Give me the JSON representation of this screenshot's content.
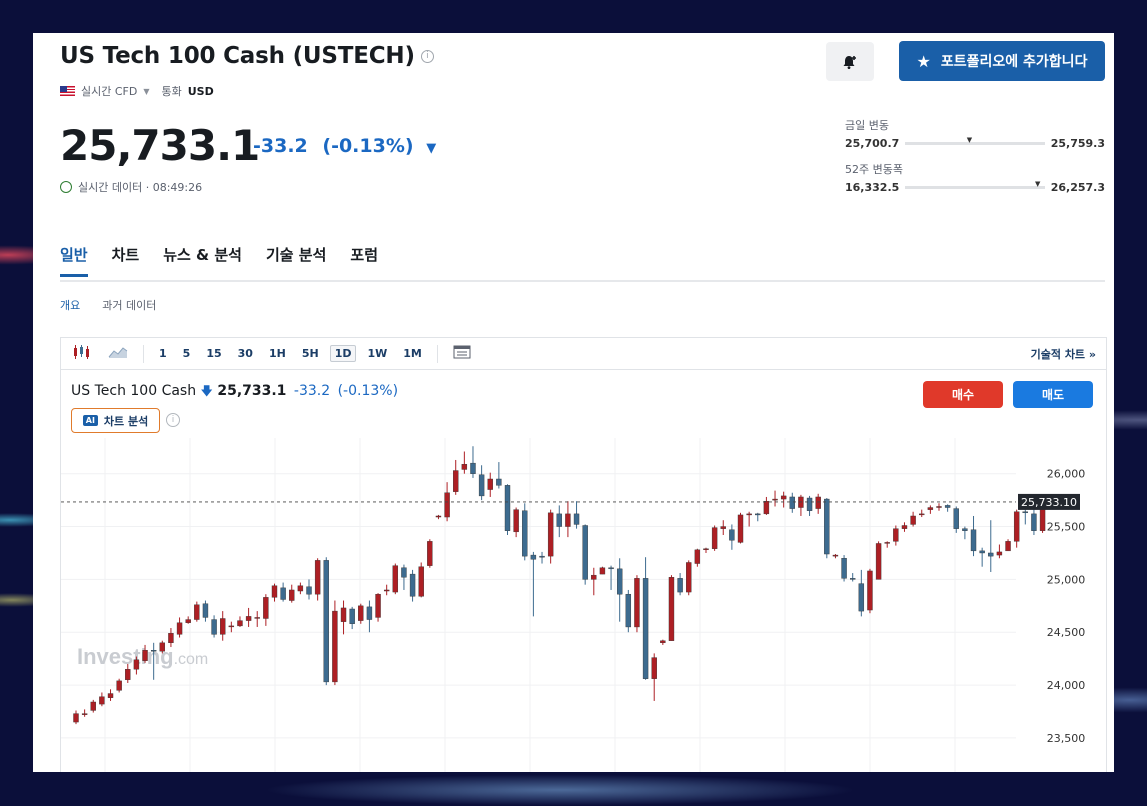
{
  "instrument": {
    "name": "US Tech 100 Cash (USTECH)",
    "feed": "실시간 CFD",
    "currency_label": "통화",
    "currency": "USD",
    "price": "25,733.1",
    "change": "-33.2",
    "change_pct": "(-0.13%)",
    "realtime": "실시간 데이터 · 08:49:26"
  },
  "actions": {
    "portfolio": "포트폴리오에 추가합니다"
  },
  "ranges": {
    "day": {
      "label": "금일 변동",
      "low": "25,700.7",
      "high": "25,759.3",
      "position": 0.46
    },
    "year": {
      "label": "52주 변동폭",
      "low": "16,332.5",
      "high": "26,257.3",
      "position": 0.95
    }
  },
  "tabs": [
    "일반",
    "차트",
    "뉴스 & 분석",
    "기술 분석",
    "포럼"
  ],
  "subtabs": [
    "개요",
    "과거 데이터"
  ],
  "toolbar": {
    "intervals": [
      "1",
      "5",
      "15",
      "30",
      "1H",
      "5H",
      "1D",
      "1W",
      "1M"
    ],
    "selected": "1D",
    "technical_chart": "기술적 차트 »"
  },
  "chart_header": {
    "name": "US Tech 100 Cash",
    "price": "25,733.1",
    "change": "-33.2",
    "change_pct": "(-0.13%)",
    "ai_badge": "AI",
    "ai_label": "차트 분석",
    "buy": "매수",
    "sell": "매도",
    "last_label": "25,733.10",
    "watermark": "Investing",
    "watermark_suffix": ".com"
  },
  "colors": {
    "up": "#ad1f24",
    "down": "#3d6b8f",
    "accent": "#1a5fa8"
  },
  "chart_data": {
    "type": "candlestick",
    "yticks": [
      23500,
      24000,
      24500,
      25000,
      25500,
      26000
    ],
    "ytick_labels": [
      "23,500",
      "24,000",
      "24,500",
      "25,000",
      "25,500",
      "26,000"
    ],
    "ylim": [
      23300,
      26300
    ],
    "last": 25733.1,
    "candles": [
      [
        23650,
        23730,
        23630,
        23760
      ],
      [
        23720,
        23730,
        23700,
        23770
      ],
      [
        23760,
        23840,
        23740,
        23860
      ],
      [
        23820,
        23890,
        23800,
        23930
      ],
      [
        23880,
        23920,
        23850,
        23960
      ],
      [
        23950,
        24040,
        23930,
        24060
      ],
      [
        24050,
        24150,
        24020,
        24200
      ],
      [
        24150,
        24240,
        24100,
        24270
      ],
      [
        24230,
        24330,
        24210,
        24380
      ],
      [
        24330,
        24320,
        24050,
        24400
      ],
      [
        24320,
        24400,
        24300,
        24420
      ],
      [
        24400,
        24490,
        24360,
        24540
      ],
      [
        24480,
        24590,
        24450,
        24640
      ],
      [
        24590,
        24620,
        24580,
        24650
      ],
      [
        24620,
        24760,
        24600,
        24790
      ],
      [
        24770,
        24640,
        24600,
        24800
      ],
      [
        24620,
        24480,
        24450,
        24660
      ],
      [
        24480,
        24630,
        24420,
        24700
      ],
      [
        24560,
        24560,
        24500,
        24600
      ],
      [
        24560,
        24610,
        24550,
        24650
      ],
      [
        24610,
        24650,
        24550,
        24730
      ],
      [
        24640,
        24640,
        24550,
        24700
      ],
      [
        24630,
        24830,
        24560,
        24860
      ],
      [
        24830,
        24940,
        24790,
        24960
      ],
      [
        24920,
        24810,
        24790,
        24970
      ],
      [
        24800,
        24900,
        24780,
        24950
      ],
      [
        24890,
        24940,
        24860,
        24970
      ],
      [
        24930,
        24860,
        24810,
        25000
      ],
      [
        24860,
        25180,
        24800,
        25200
      ],
      [
        25180,
        24030,
        24000,
        25210
      ],
      [
        24030,
        24700,
        24000,
        24800
      ],
      [
        24600,
        24730,
        24480,
        24800
      ],
      [
        24720,
        24580,
        24530,
        24740
      ],
      [
        24610,
        24750,
        24580,
        24770
      ],
      [
        24740,
        24620,
        24500,
        24800
      ],
      [
        24640,
        24860,
        24600,
        24870
      ],
      [
        24890,
        24900,
        24850,
        24950
      ],
      [
        24880,
        25130,
        24860,
        25150
      ],
      [
        25110,
        25020,
        24900,
        25140
      ],
      [
        25050,
        24840,
        24790,
        25090
      ],
      [
        24840,
        25120,
        24830,
        25160
      ],
      [
        25130,
        25360,
        25110,
        25380
      ],
      [
        25590,
        25600,
        25570,
        25610
      ],
      [
        25590,
        25820,
        25550,
        25920
      ],
      [
        25830,
        26030,
        25800,
        26130
      ],
      [
        26040,
        26090,
        26000,
        26210
      ],
      [
        26100,
        26000,
        25960,
        26260
      ],
      [
        25990,
        25790,
        25750,
        26080
      ],
      [
        25850,
        25950,
        25780,
        26010
      ],
      [
        25950,
        25890,
        25860,
        26110
      ],
      [
        25890,
        25460,
        25420,
        25900
      ],
      [
        25450,
        25660,
        25400,
        25680
      ],
      [
        25650,
        25220,
        25180,
        25720
      ],
      [
        25230,
        25190,
        24650,
        25260
      ],
      [
        25220,
        25210,
        25150,
        25260
      ],
      [
        25220,
        25630,
        25150,
        25660
      ],
      [
        25620,
        25500,
        25400,
        25700
      ],
      [
        25500,
        25620,
        25400,
        25740
      ],
      [
        25620,
        25520,
        25480,
        25740
      ],
      [
        25510,
        25000,
        24950,
        25520
      ],
      [
        25000,
        25040,
        24850,
        25110
      ],
      [
        25050,
        25110,
        25050,
        25120
      ],
      [
        25110,
        25100,
        24900,
        25130
      ],
      [
        25100,
        24860,
        24600,
        25200
      ],
      [
        24860,
        24550,
        24500,
        24900
      ],
      [
        24550,
        25010,
        24500,
        25040
      ],
      [
        25010,
        24060,
        24050,
        25210
      ],
      [
        24060,
        24260,
        23850,
        24300
      ],
      [
        24400,
        24420,
        24380,
        24430
      ],
      [
        24420,
        25020,
        24420,
        25040
      ],
      [
        25010,
        24880,
        24850,
        25060
      ],
      [
        24880,
        25160,
        24850,
        25180
      ],
      [
        25150,
        25280,
        25120,
        25290
      ],
      [
        25280,
        25290,
        25250,
        25300
      ],
      [
        25290,
        25490,
        25270,
        25510
      ],
      [
        25480,
        25500,
        25420,
        25560
      ],
      [
        25470,
        25370,
        25280,
        25520
      ],
      [
        25350,
        25610,
        25340,
        25630
      ],
      [
        25610,
        25620,
        25500,
        25640
      ],
      [
        25620,
        25610,
        25550,
        25630
      ],
      [
        25620,
        25740,
        25610,
        25780
      ],
      [
        25750,
        25760,
        25690,
        25840
      ],
      [
        25760,
        25790,
        25680,
        25830
      ],
      [
        25780,
        25670,
        25630,
        25820
      ],
      [
        25680,
        25780,
        25600,
        25800
      ],
      [
        25770,
        25650,
        25600,
        25790
      ],
      [
        25670,
        25780,
        25620,
        25810
      ],
      [
        25760,
        25240,
        25200,
        25770
      ],
      [
        25220,
        25230,
        25200,
        25240
      ],
      [
        25200,
        25010,
        24980,
        25230
      ],
      [
        25010,
        25000,
        24980,
        25060
      ],
      [
        24960,
        24700,
        24650,
        25090
      ],
      [
        24710,
        25080,
        24680,
        25100
      ],
      [
        25000,
        25340,
        25000,
        25360
      ],
      [
        25350,
        25350,
        25300,
        25360
      ],
      [
        25360,
        25480,
        25320,
        25510
      ],
      [
        25480,
        25510,
        25450,
        25540
      ],
      [
        25520,
        25600,
        25500,
        25640
      ],
      [
        25620,
        25620,
        25590,
        25660
      ],
      [
        25660,
        25680,
        25620,
        25700
      ],
      [
        25680,
        25690,
        25650,
        25720
      ],
      [
        25700,
        25680,
        25640,
        25710
      ],
      [
        25670,
        25480,
        25440,
        25690
      ],
      [
        25480,
        25460,
        25380,
        25500
      ],
      [
        25470,
        25270,
        25220,
        25600
      ],
      [
        25270,
        25250,
        25120,
        25300
      ],
      [
        25250,
        25220,
        25070,
        25560
      ],
      [
        25230,
        25260,
        25200,
        25330
      ],
      [
        25270,
        25360,
        25270,
        25380
      ],
      [
        25360,
        25640,
        25300,
        25660
      ],
      [
        25640,
        25630,
        25520,
        25660
      ],
      [
        25620,
        25460,
        25420,
        25700
      ],
      [
        25460,
        25760,
        25440,
        25780
      ],
      [
        25760,
        25740,
        25700,
        25790
      ]
    ]
  }
}
